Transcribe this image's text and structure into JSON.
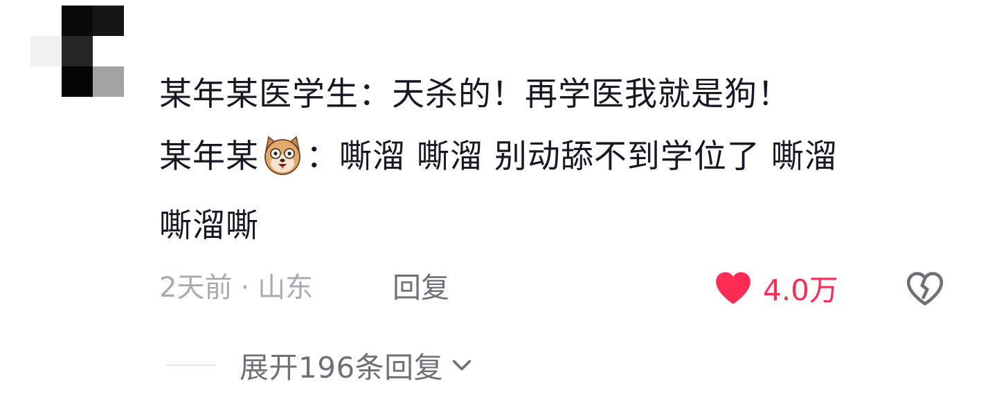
{
  "comment": {
    "author_line1": {
      "text": "某年某医学生：天杀的！再学医我就是狗！"
    },
    "author_line2": {
      "before_emoji": "某年某",
      "emoji_icon": "dog-face-emoji",
      "after_emoji": "：嘶溜 嘶溜 别动舔不到学位了 嘶溜"
    },
    "author_line3": {
      "text": "嘶溜嘶"
    },
    "time": "2天前",
    "separator": "·",
    "location": "山东",
    "reply_label": "回复",
    "like_count": "4.0万",
    "liked": true,
    "expand_label": "展开196条回复"
  },
  "colors": {
    "like_red": "#fe2c55",
    "meta_gray": "#a9abb2",
    "action_gray": "#6f7079"
  },
  "icons": {
    "like": "heart-icon",
    "dislike": "broken-heart-icon",
    "expand": "chevron-down-icon"
  }
}
